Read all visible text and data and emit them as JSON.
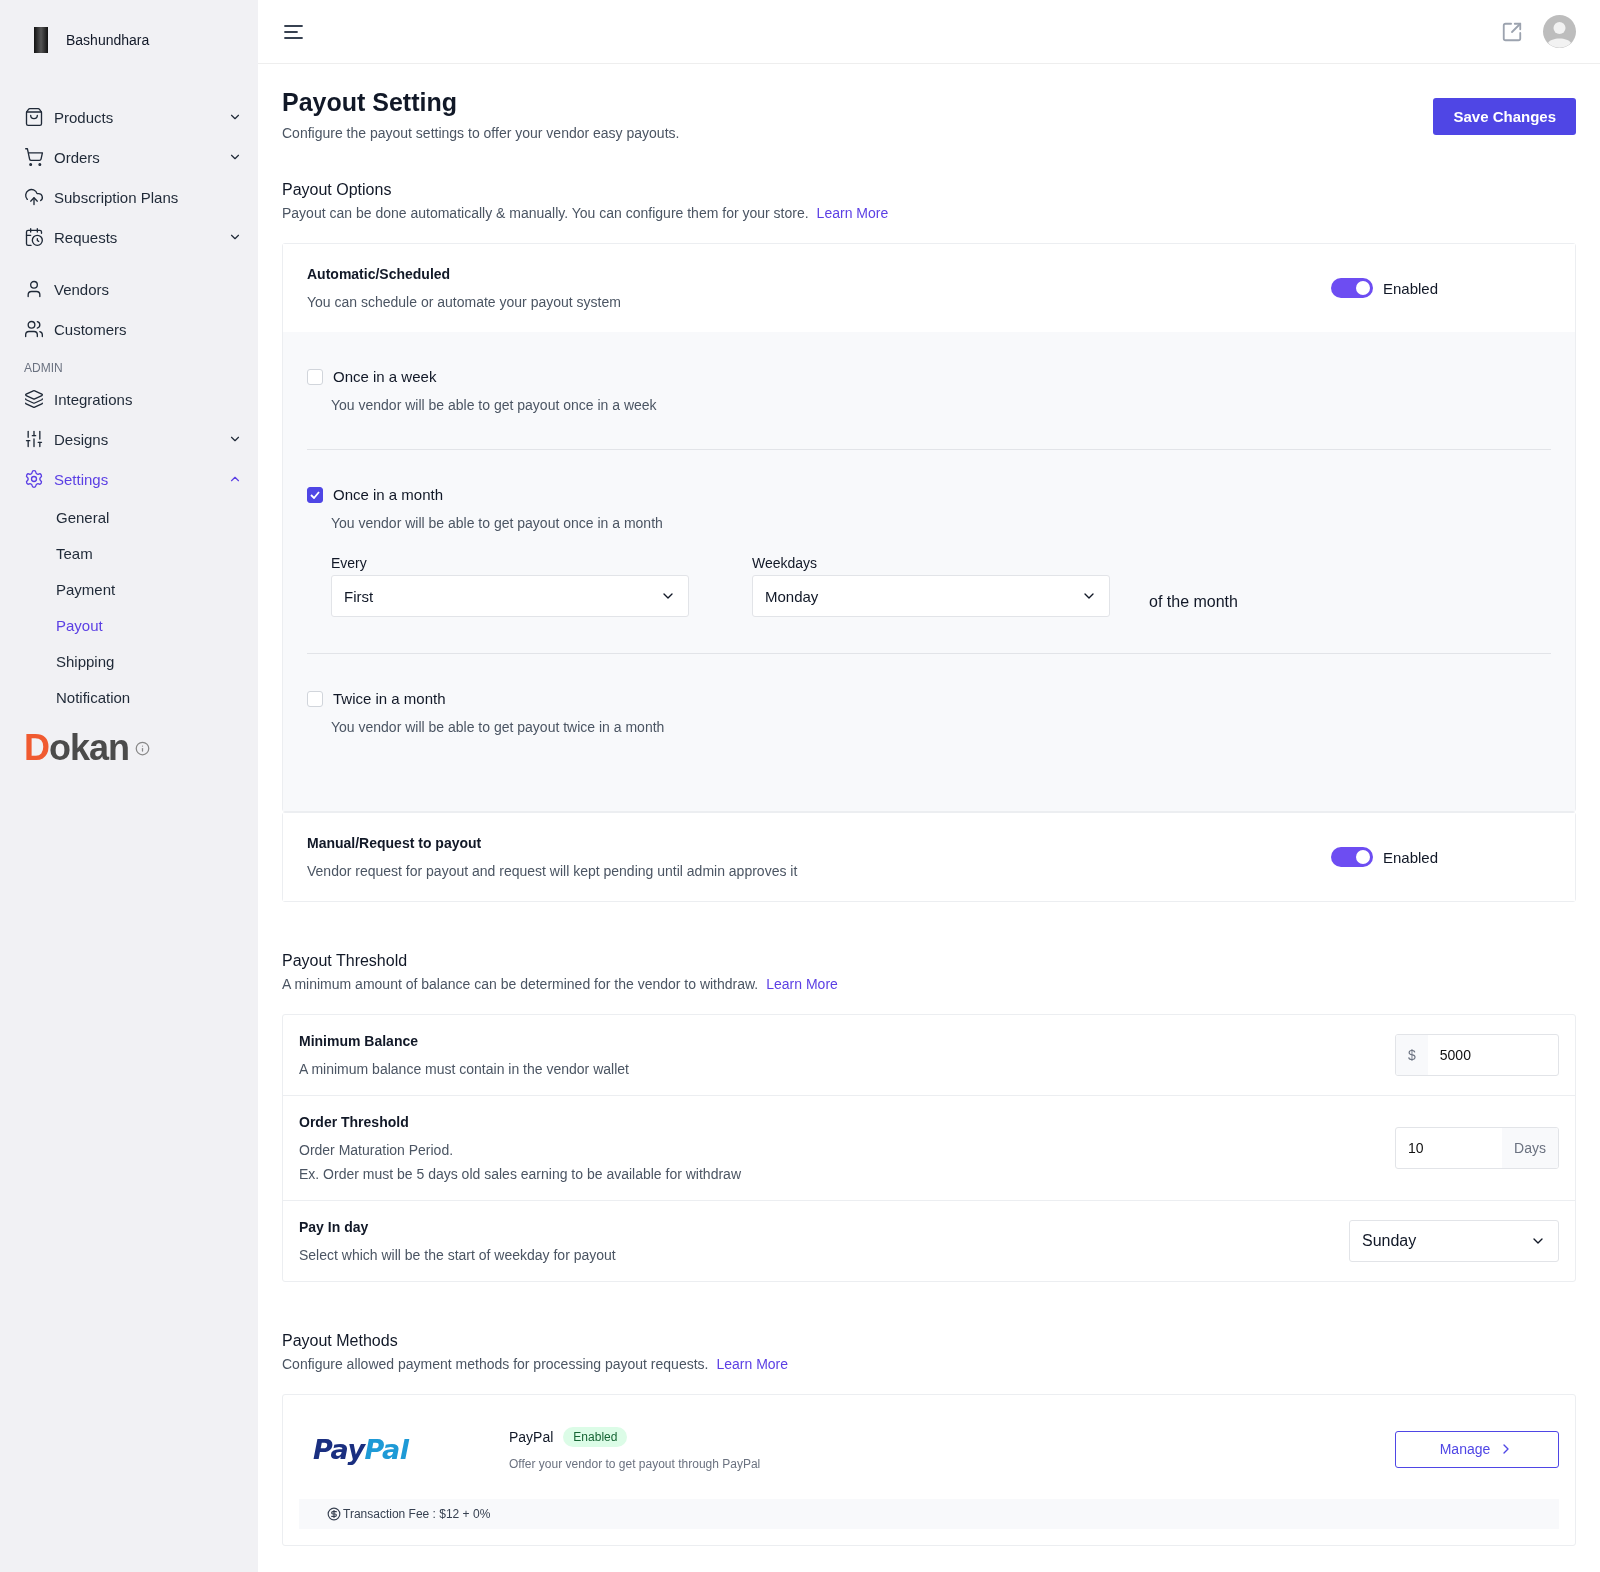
{
  "sidebar": {
    "store_name": "Bashundhara",
    "sections": [
      {
        "items": [
          {
            "label": "Products",
            "expanded": false,
            "selected": false
          },
          {
            "label": "Orders",
            "expanded": false,
            "selected": false
          },
          {
            "label": "Subscription Plans",
            "selected": false
          },
          {
            "label": "Requests",
            "expanded": false,
            "selected": false
          }
        ]
      },
      {
        "items": [
          {
            "label": "Vendors",
            "selected": false
          },
          {
            "label": "Customers",
            "selected": false
          }
        ]
      },
      {
        "label": "ADMIN",
        "items": [
          {
            "label": "Integrations",
            "selected": false
          },
          {
            "label": "Designs",
            "expanded": false,
            "selected": false
          },
          {
            "label": "Settings",
            "expanded": true,
            "selected": true,
            "children": [
              {
                "label": "General",
                "selected": false
              },
              {
                "label": "Team",
                "selected": false
              },
              {
                "label": "Payment",
                "selected": false
              },
              {
                "label": "Payout",
                "selected": true
              },
              {
                "label": "Shipping",
                "selected": false
              },
              {
                "label": "Notification",
                "selected": false
              }
            ]
          }
        ]
      }
    ],
    "brand": {
      "initial": "D",
      "rest": "okan"
    }
  },
  "page": {
    "title": "Payout Setting",
    "subtitle": "Configure the payout settings to offer your vendor easy payouts.",
    "save_button": "Save Changes"
  },
  "payout_options": {
    "title": "Payout Options",
    "description": "Payout can be done automatically & manually. You can configure them for your store.",
    "link": "Learn More",
    "automatic": {
      "title": "Automatic/Scheduled",
      "description": "You can schedule or automate your payout system",
      "on": true,
      "toggle_label": "Enabled",
      "schedules": [
        {
          "label": "Once in a week",
          "description": "You vendor will be able to get payout once in a week",
          "checked": false
        },
        {
          "label": "Once in a month",
          "description": "You vendor will be able to get payout once in a month",
          "checked": true,
          "fields": [
            {
              "label": "Every",
              "value": "First"
            },
            {
              "label": "Weekdays",
              "value": "Monday"
            }
          ],
          "suffix": "of the month"
        },
        {
          "label": "Twice in a month",
          "description": "You vendor will be able to get payout twice in a month",
          "checked": false
        }
      ]
    },
    "manual": {
      "title": "Manual/Request to payout",
      "description": "Vendor request for payout and request will kept pending until admin approves it",
      "on": true,
      "toggle_label": "Enabled"
    }
  },
  "payout_threshold": {
    "title": "Payout Threshold",
    "description": "A minimum amount of balance can be determined for the vendor to withdraw.",
    "link": "Learn More",
    "rows": [
      {
        "kind": "prefix",
        "title": "Minimum Balance",
        "lines": [
          "A minimum balance must contain in the vendor wallet"
        ],
        "addon": "$",
        "value": "5000"
      },
      {
        "kind": "suffix",
        "title": "Order Threshold",
        "lines": [
          "Order Maturation Period.",
          "Ex. Order must be 5 days old sales earning to be available for withdraw"
        ],
        "addon": "Days",
        "value": "10"
      },
      {
        "kind": "select",
        "title": "Pay In day",
        "lines": [
          "Select which will be the start of weekday for payout"
        ],
        "value": "Sunday"
      }
    ]
  },
  "payout_methods": {
    "title": "Payout Methods",
    "description": "Configure allowed payment methods for processing payout requests.",
    "link": "Learn More",
    "methods": [
      {
        "logo_first": "Pay",
        "logo_second": "Pal",
        "name": "PayPal",
        "status": "Enabled",
        "description": "Offer your vendor to get payout through PayPal",
        "button": "Manage",
        "fee": "Transaction Fee : $12 + 0%"
      }
    ]
  }
}
